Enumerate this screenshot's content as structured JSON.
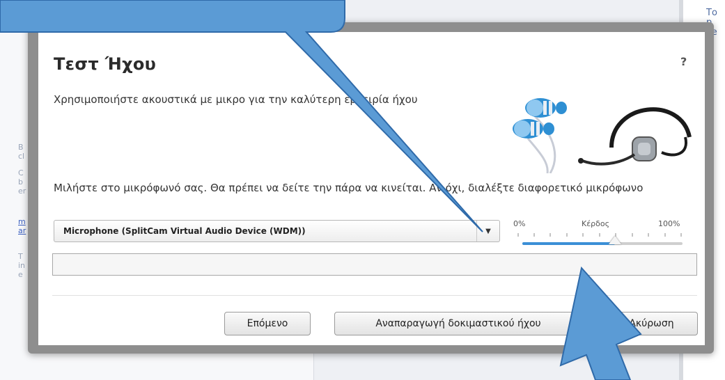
{
  "background": {
    "right_fragment": "Το\np\nve\n\nai",
    "left_fragments": [
      "B\ncl",
      "C\nb\ner",
      "m\nar",
      "T\nin\ne"
    ]
  },
  "dialog": {
    "title": "Τεστ Ήχου",
    "help": "?",
    "description": "Χρησιμοποιήστε ακουστικά με μικρο         για την καλύτερη εμπειρία ήχου",
    "instruction": "Μιλήστε στο μικρόφωνό σας. Θα πρέπει να δείτε την      πάρα να κινείται. Αν όχι, διαλέξτε διαφορετικό μικρόφωνο",
    "microphone": {
      "selected": "Microphone (SplitCam Virtual Audio Device (WDM))"
    },
    "gain": {
      "label_min": "0%",
      "label_title": "Κέρδος",
      "label_max": "100%",
      "level": 0.58
    },
    "buttons": {
      "next": "Επόμενο",
      "play_test": "Αναπαραγωγή δοκιμαστικού ήχου",
      "cancel": "Ακύρωση"
    }
  },
  "colors": {
    "callout": "#5b9bd5",
    "callout_border": "#2f6aa9",
    "gain_fill": "#3b8fd6"
  }
}
